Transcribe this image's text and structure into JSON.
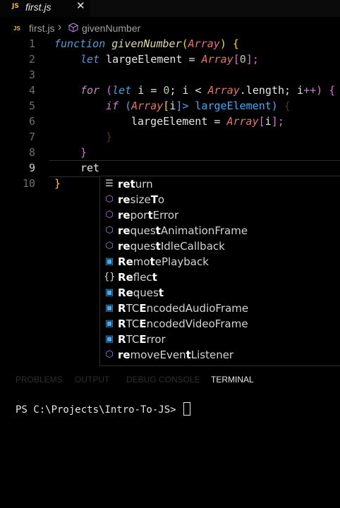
{
  "tab": {
    "icon": "JS",
    "label": "first.js",
    "close": "✕"
  },
  "breadcrumb": {
    "file": "first.js",
    "separator": "›",
    "symbol": "givenNumber",
    "symbol_icon": "cube-icon"
  },
  "line_numbers": [
    "1",
    "2",
    "3",
    "4",
    "5",
    "6",
    "7",
    "8",
    "9",
    "10"
  ],
  "code": {
    "l1": [
      "function",
      " ",
      "givenNumber",
      "(",
      "Array",
      ") ",
      "{"
    ],
    "l2": [
      "let",
      " largeElement = ",
      "Array",
      "[",
      "0",
      "];"
    ],
    "l4": [
      "for",
      " ",
      "(",
      "let",
      " i = ",
      "0",
      "; i < ",
      "Array",
      ".length; i",
      "++",
      ") ",
      "{"
    ],
    "l5": [
      "if",
      " (",
      "Array",
      "[",
      "i",
      "]> largeElement) ",
      "{"
    ],
    "l6": [
      "largeElement = ",
      "Array",
      "[",
      "i",
      "];"
    ],
    "l7": [
      "}"
    ],
    "l8": [
      "}"
    ],
    "l9": [
      "ret"
    ],
    "l10": [
      "}"
    ]
  },
  "suggestions": [
    {
      "icon": "keyword-icon",
      "glyph": "☰",
      "color": "#e0e0e0",
      "label": "return"
    },
    {
      "icon": "method-icon",
      "glyph": "⬡",
      "color": "#b180d7",
      "label": "resizeTo"
    },
    {
      "icon": "method-icon",
      "glyph": "⬡",
      "color": "#b180d7",
      "label": "reportError"
    },
    {
      "icon": "method-icon",
      "glyph": "⬡",
      "color": "#b180d7",
      "label": "requestAnimationFrame"
    },
    {
      "icon": "method-icon",
      "glyph": "⬡",
      "color": "#b180d7",
      "label": "requestIdleCallback"
    },
    {
      "icon": "variable-icon",
      "glyph": "▣",
      "color": "#4aa8f0",
      "label": "RemotePlayback"
    },
    {
      "icon": "namespace-icon",
      "glyph": "{}",
      "color": "#e0e0e0",
      "label": "Reflect"
    },
    {
      "icon": "variable-icon",
      "glyph": "▣",
      "color": "#4aa8f0",
      "label": "Request"
    },
    {
      "icon": "variable-icon",
      "glyph": "▣",
      "color": "#4aa8f0",
      "label": "RTCEncodedAudioFrame"
    },
    {
      "icon": "variable-icon",
      "glyph": "▣",
      "color": "#4aa8f0",
      "label": "RTCEncodedVideoFrame"
    },
    {
      "icon": "variable-icon",
      "glyph": "▣",
      "color": "#4aa8f0",
      "label": "RTCError"
    },
    {
      "icon": "method-icon",
      "glyph": "⬡",
      "color": "#b180d7",
      "label": "removeEventListener"
    }
  ],
  "panel": {
    "problems": "PROBLEMS",
    "output": "OUTPUT",
    "debug": "DEBUG CONSOLE",
    "terminal": "TERMINAL"
  },
  "terminal": {
    "prompt": "PS C:\\Projects\\Intro-To-JS> "
  }
}
